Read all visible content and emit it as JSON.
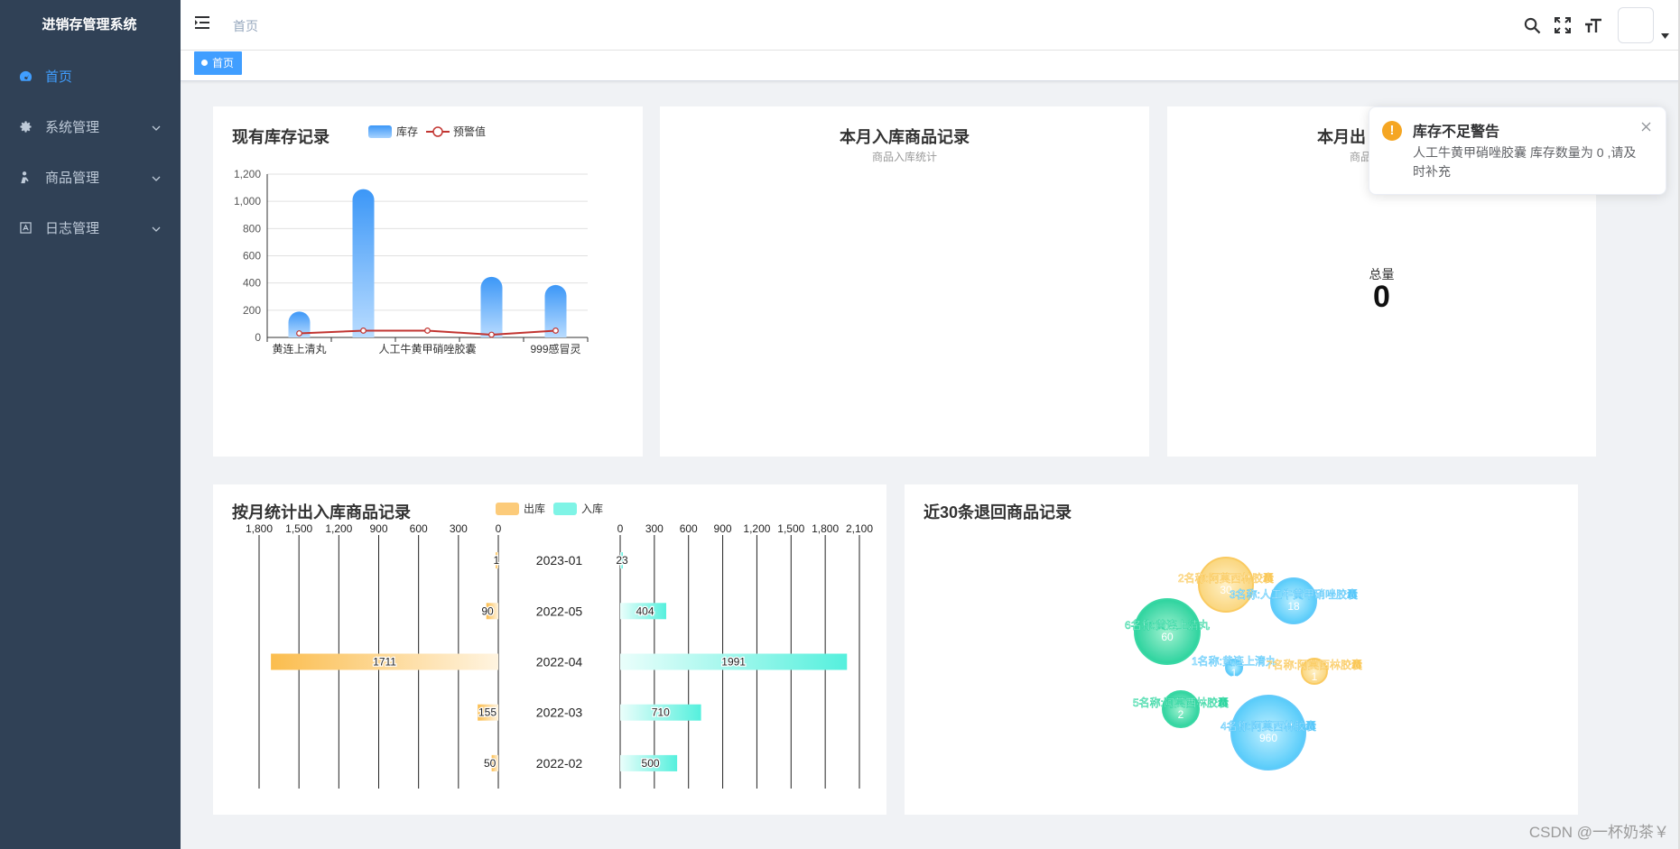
{
  "app": {
    "title": "进销存管理系统"
  },
  "sidebar": {
    "items": [
      {
        "label": "首页",
        "icon": "dashboard-icon",
        "active": true
      },
      {
        "label": "系统管理",
        "icon": "gear-icon"
      },
      {
        "label": "商品管理",
        "icon": "user-icon"
      },
      {
        "label": "日志管理",
        "icon": "log-icon"
      }
    ]
  },
  "navbar": {
    "breadcrumb": "首页"
  },
  "tags": {
    "home": "首页"
  },
  "colors": {
    "sidebar_bg": "#304156",
    "accent": "#409eff",
    "stock_line": "#c23531",
    "out_bar": "#fac858",
    "in_bar": "#5cefe0"
  },
  "stock_card": {
    "title": "现有库存记录",
    "legend": [
      "库存",
      "预警值"
    ],
    "chart_data": {
      "type": "bar",
      "categories": [
        "黄连上清丸",
        "",
        "人工牛黄甲硝唑胶囊",
        "",
        "999感冒灵"
      ],
      "series": [
        {
          "name": "库存",
          "type": "bar",
          "values": [
            190,
            1090,
            null,
            445,
            385
          ]
        },
        {
          "name": "预警值",
          "type": "line",
          "values": [
            30,
            50,
            50,
            20,
            50
          ]
        }
      ],
      "ylim": [
        0,
        1200
      ],
      "yticks": [
        "0",
        "200",
        "400",
        "600",
        "800",
        "1,000",
        "1,200"
      ]
    }
  },
  "in_card": {
    "title": "本月入库商品记录",
    "subtitle": "商品入库统计"
  },
  "out_card": {
    "title": "本月出",
    "subtitle": "商品",
    "total_label": "总量",
    "total_value": "0"
  },
  "monthly_card": {
    "title": "按月统计出入库商品记录",
    "legend": [
      "出库",
      "入库"
    ],
    "chart_data": {
      "type": "bar",
      "categories": [
        "2023-01",
        "2022-05",
        "2022-04",
        "2022-03",
        "2022-02"
      ],
      "series": [
        {
          "name": "出库",
          "values": [
            1,
            90,
            1711,
            155,
            50
          ]
        },
        {
          "name": "入库",
          "values": [
            23,
            404,
            1991,
            710,
            500
          ]
        }
      ],
      "out_ticks": [
        "1,800",
        "1,500",
        "1,200",
        "900",
        "600",
        "300",
        "0"
      ],
      "in_ticks": [
        "0",
        "300",
        "600",
        "900",
        "1,200",
        "1,500",
        "1,800",
        "2,100"
      ]
    }
  },
  "return_card": {
    "title": "近30条退回商品记录",
    "chart_data": {
      "type": "scatter",
      "bubbles": [
        {
          "label": "2名称:阿莫西林胶囊",
          "value": 30,
          "color": "#fac858"
        },
        {
          "label": "3名称:人工牛黄甲硝唑胶囊",
          "value": 18,
          "color": "#5ac8fa"
        },
        {
          "label": "6名称:黄连上清丸",
          "value": 60,
          "color": "#2fd6a0"
        },
        {
          "label": "1名称:黄连上清丸",
          "value": 1,
          "color": "#5ac8fa"
        },
        {
          "label": "7名称:阿莫西林胶囊",
          "value": 1,
          "color": "#fac858"
        },
        {
          "label": "5名称:阿莫西林胶囊",
          "value": 2,
          "color": "#2fd6a0"
        },
        {
          "label": "4名称:阿莫西林胶囊",
          "value": 960,
          "color": "#5ac8fa"
        }
      ]
    }
  },
  "notification": {
    "title": "库存不足警告",
    "message": "人工牛黄甲硝唑胶囊 库存数量为 0 ,请及时补充"
  },
  "watermark": "CSDN @一杯奶茶￥"
}
